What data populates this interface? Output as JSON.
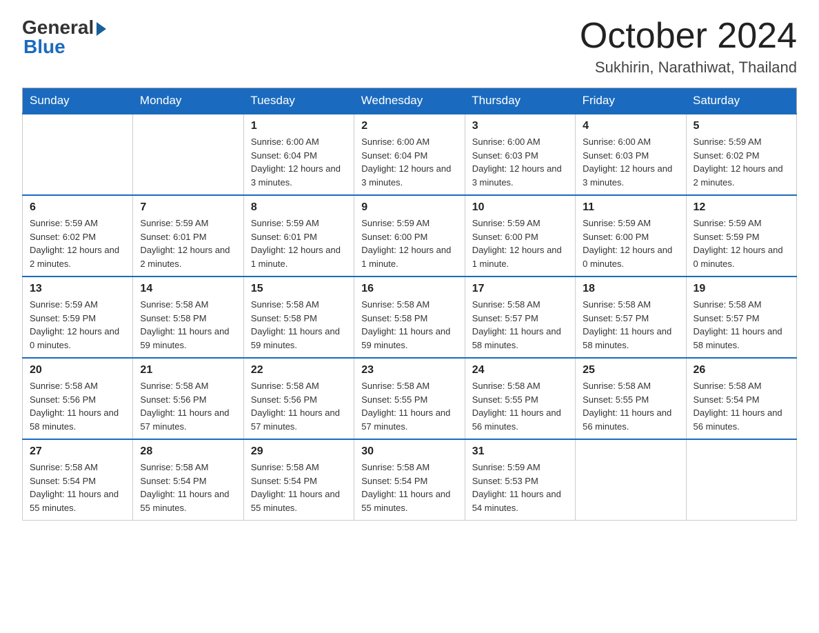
{
  "logo": {
    "general": "General",
    "blue": "Blue"
  },
  "title": "October 2024",
  "location": "Sukhirin, Narathiwat, Thailand",
  "headers": [
    "Sunday",
    "Monday",
    "Tuesday",
    "Wednesday",
    "Thursday",
    "Friday",
    "Saturday"
  ],
  "weeks": [
    [
      {
        "day": "",
        "sunrise": "",
        "sunset": "",
        "daylight": ""
      },
      {
        "day": "",
        "sunrise": "",
        "sunset": "",
        "daylight": ""
      },
      {
        "day": "1",
        "sunrise": "Sunrise: 6:00 AM",
        "sunset": "Sunset: 6:04 PM",
        "daylight": "Daylight: 12 hours and 3 minutes."
      },
      {
        "day": "2",
        "sunrise": "Sunrise: 6:00 AM",
        "sunset": "Sunset: 6:04 PM",
        "daylight": "Daylight: 12 hours and 3 minutes."
      },
      {
        "day": "3",
        "sunrise": "Sunrise: 6:00 AM",
        "sunset": "Sunset: 6:03 PM",
        "daylight": "Daylight: 12 hours and 3 minutes."
      },
      {
        "day": "4",
        "sunrise": "Sunrise: 6:00 AM",
        "sunset": "Sunset: 6:03 PM",
        "daylight": "Daylight: 12 hours and 3 minutes."
      },
      {
        "day": "5",
        "sunrise": "Sunrise: 5:59 AM",
        "sunset": "Sunset: 6:02 PM",
        "daylight": "Daylight: 12 hours and 2 minutes."
      }
    ],
    [
      {
        "day": "6",
        "sunrise": "Sunrise: 5:59 AM",
        "sunset": "Sunset: 6:02 PM",
        "daylight": "Daylight: 12 hours and 2 minutes."
      },
      {
        "day": "7",
        "sunrise": "Sunrise: 5:59 AM",
        "sunset": "Sunset: 6:01 PM",
        "daylight": "Daylight: 12 hours and 2 minutes."
      },
      {
        "day": "8",
        "sunrise": "Sunrise: 5:59 AM",
        "sunset": "Sunset: 6:01 PM",
        "daylight": "Daylight: 12 hours and 1 minute."
      },
      {
        "day": "9",
        "sunrise": "Sunrise: 5:59 AM",
        "sunset": "Sunset: 6:00 PM",
        "daylight": "Daylight: 12 hours and 1 minute."
      },
      {
        "day": "10",
        "sunrise": "Sunrise: 5:59 AM",
        "sunset": "Sunset: 6:00 PM",
        "daylight": "Daylight: 12 hours and 1 minute."
      },
      {
        "day": "11",
        "sunrise": "Sunrise: 5:59 AM",
        "sunset": "Sunset: 6:00 PM",
        "daylight": "Daylight: 12 hours and 0 minutes."
      },
      {
        "day": "12",
        "sunrise": "Sunrise: 5:59 AM",
        "sunset": "Sunset: 5:59 PM",
        "daylight": "Daylight: 12 hours and 0 minutes."
      }
    ],
    [
      {
        "day": "13",
        "sunrise": "Sunrise: 5:59 AM",
        "sunset": "Sunset: 5:59 PM",
        "daylight": "Daylight: 12 hours and 0 minutes."
      },
      {
        "day": "14",
        "sunrise": "Sunrise: 5:58 AM",
        "sunset": "Sunset: 5:58 PM",
        "daylight": "Daylight: 11 hours and 59 minutes."
      },
      {
        "day": "15",
        "sunrise": "Sunrise: 5:58 AM",
        "sunset": "Sunset: 5:58 PM",
        "daylight": "Daylight: 11 hours and 59 minutes."
      },
      {
        "day": "16",
        "sunrise": "Sunrise: 5:58 AM",
        "sunset": "Sunset: 5:58 PM",
        "daylight": "Daylight: 11 hours and 59 minutes."
      },
      {
        "day": "17",
        "sunrise": "Sunrise: 5:58 AM",
        "sunset": "Sunset: 5:57 PM",
        "daylight": "Daylight: 11 hours and 58 minutes."
      },
      {
        "day": "18",
        "sunrise": "Sunrise: 5:58 AM",
        "sunset": "Sunset: 5:57 PM",
        "daylight": "Daylight: 11 hours and 58 minutes."
      },
      {
        "day": "19",
        "sunrise": "Sunrise: 5:58 AM",
        "sunset": "Sunset: 5:57 PM",
        "daylight": "Daylight: 11 hours and 58 minutes."
      }
    ],
    [
      {
        "day": "20",
        "sunrise": "Sunrise: 5:58 AM",
        "sunset": "Sunset: 5:56 PM",
        "daylight": "Daylight: 11 hours and 58 minutes."
      },
      {
        "day": "21",
        "sunrise": "Sunrise: 5:58 AM",
        "sunset": "Sunset: 5:56 PM",
        "daylight": "Daylight: 11 hours and 57 minutes."
      },
      {
        "day": "22",
        "sunrise": "Sunrise: 5:58 AM",
        "sunset": "Sunset: 5:56 PM",
        "daylight": "Daylight: 11 hours and 57 minutes."
      },
      {
        "day": "23",
        "sunrise": "Sunrise: 5:58 AM",
        "sunset": "Sunset: 5:55 PM",
        "daylight": "Daylight: 11 hours and 57 minutes."
      },
      {
        "day": "24",
        "sunrise": "Sunrise: 5:58 AM",
        "sunset": "Sunset: 5:55 PM",
        "daylight": "Daylight: 11 hours and 56 minutes."
      },
      {
        "day": "25",
        "sunrise": "Sunrise: 5:58 AM",
        "sunset": "Sunset: 5:55 PM",
        "daylight": "Daylight: 11 hours and 56 minutes."
      },
      {
        "day": "26",
        "sunrise": "Sunrise: 5:58 AM",
        "sunset": "Sunset: 5:54 PM",
        "daylight": "Daylight: 11 hours and 56 minutes."
      }
    ],
    [
      {
        "day": "27",
        "sunrise": "Sunrise: 5:58 AM",
        "sunset": "Sunset: 5:54 PM",
        "daylight": "Daylight: 11 hours and 55 minutes."
      },
      {
        "day": "28",
        "sunrise": "Sunrise: 5:58 AM",
        "sunset": "Sunset: 5:54 PM",
        "daylight": "Daylight: 11 hours and 55 minutes."
      },
      {
        "day": "29",
        "sunrise": "Sunrise: 5:58 AM",
        "sunset": "Sunset: 5:54 PM",
        "daylight": "Daylight: 11 hours and 55 minutes."
      },
      {
        "day": "30",
        "sunrise": "Sunrise: 5:58 AM",
        "sunset": "Sunset: 5:54 PM",
        "daylight": "Daylight: 11 hours and 55 minutes."
      },
      {
        "day": "31",
        "sunrise": "Sunrise: 5:59 AM",
        "sunset": "Sunset: 5:53 PM",
        "daylight": "Daylight: 11 hours and 54 minutes."
      },
      {
        "day": "",
        "sunrise": "",
        "sunset": "",
        "daylight": ""
      },
      {
        "day": "",
        "sunrise": "",
        "sunset": "",
        "daylight": ""
      }
    ]
  ]
}
